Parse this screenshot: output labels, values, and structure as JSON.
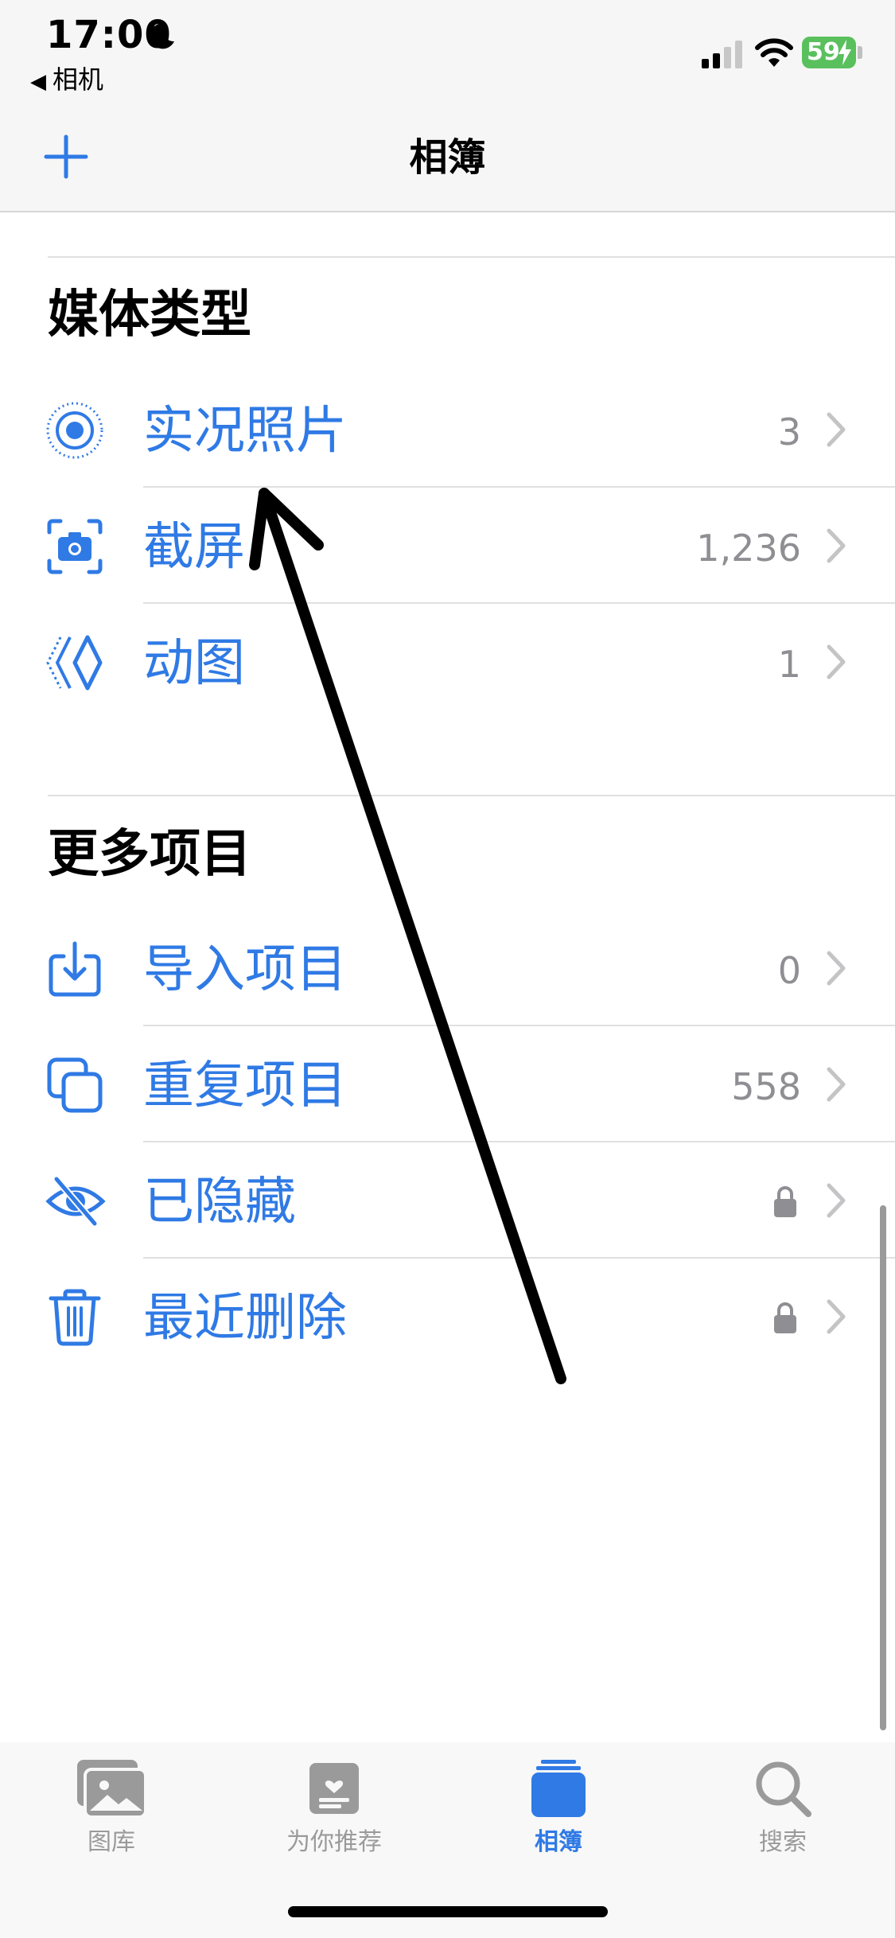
{
  "status": {
    "time": "17:00",
    "back_app": "相机",
    "battery": "59"
  },
  "nav": {
    "title": "相簿"
  },
  "media_types": {
    "title": "媒体类型",
    "items": [
      {
        "label": "实况照片",
        "count": "3",
        "icon": "live-photo-icon"
      },
      {
        "label": "截屏",
        "count": "1,236",
        "icon": "screenshot-icon"
      },
      {
        "label": "动图",
        "count": "1",
        "icon": "animated-icon"
      }
    ]
  },
  "more_items": {
    "title": "更多项目",
    "items": [
      {
        "label": "导入项目",
        "count": "0",
        "icon": "import-icon"
      },
      {
        "label": "重复项目",
        "count": "558",
        "icon": "duplicate-icon"
      },
      {
        "label": "已隐藏",
        "icon": "hidden-eye-icon",
        "locked": true
      },
      {
        "label": "最近删除",
        "icon": "trash-icon",
        "locked": true
      }
    ]
  },
  "tabs": [
    {
      "label": "图库",
      "icon": "photo-library-icon"
    },
    {
      "label": "为你推荐",
      "icon": "for-you-icon"
    },
    {
      "label": "相簿",
      "icon": "albums-icon",
      "active": true
    },
    {
      "label": "搜索",
      "icon": "search-icon"
    }
  ],
  "colors": {
    "accent": "#2f7ae5",
    "secondary_text": "#8e8e93",
    "battery": "#5ac05d"
  }
}
